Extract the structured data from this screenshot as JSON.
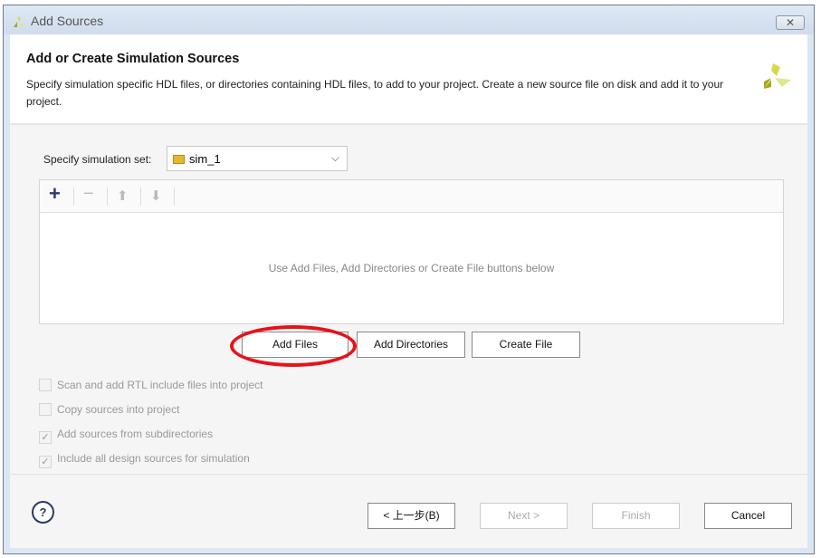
{
  "window": {
    "title": "Add Sources",
    "close_label": "✕"
  },
  "header": {
    "title": "Add or Create Simulation Sources",
    "description": "Specify simulation specific HDL files, or directories containing HDL files, to add to your project. Create a new source file on disk and add it to your project."
  },
  "simset": {
    "label": "Specify simulation set:",
    "value": "sim_1"
  },
  "toolbar": {
    "add": "+",
    "remove": "−",
    "up": "⬆",
    "down": "⬇"
  },
  "list": {
    "empty_text": "Use Add Files, Add Directories or Create File buttons below"
  },
  "buttons": {
    "add_files": "Add Files",
    "add_directories": "Add Directories",
    "create_file": "Create File"
  },
  "options": [
    {
      "label": "Scan and add RTL include files into project",
      "checked": false
    },
    {
      "label": "Copy sources into project",
      "checked": false
    },
    {
      "label": "Add sources from subdirectories",
      "checked": true
    },
    {
      "label": "Include all design sources for simulation",
      "checked": true
    }
  ],
  "footer": {
    "help": "?",
    "back": "< 上一步(B)",
    "next": "Next >",
    "finish": "Finish",
    "cancel": "Cancel"
  },
  "colors": {
    "highlight": "#e8121a",
    "logo_dark": "#a3a81e",
    "logo_light": "#e3e68a"
  }
}
